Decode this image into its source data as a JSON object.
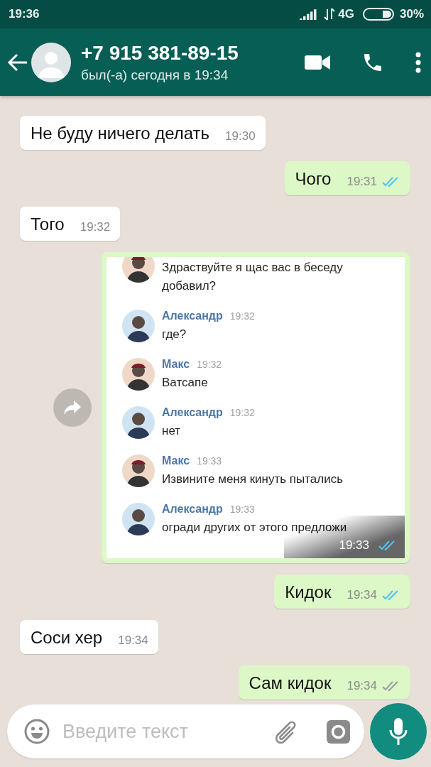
{
  "status_bar": {
    "time": "19:36",
    "network": "4G",
    "battery": "30%"
  },
  "header": {
    "contact": "+7 915 381-89-15",
    "last_seen": "был(-а) сегодня в 19:34"
  },
  "messages": [
    {
      "kind": "text",
      "outgoing": false,
      "text": "Не буду ничего делать",
      "time": "19:30"
    },
    {
      "kind": "text",
      "outgoing": true,
      "text": "Чого",
      "time": "19:31",
      "read": true
    },
    {
      "kind": "text",
      "outgoing": false,
      "text": "Того",
      "time": "19:32"
    },
    {
      "kind": "image",
      "outgoing": true,
      "time": "19:33",
      "read": true,
      "forward": true,
      "entries": [
        {
          "text": "Здраствуйте я щас вас в беседу добавил?"
        },
        {
          "sender": "Александр",
          "time": "19:32",
          "text": "где?"
        },
        {
          "sender": "Макс",
          "time": "19:32",
          "text": "Ватсапе"
        },
        {
          "sender": "Александр",
          "time": "19:32",
          "text": "нет"
        },
        {
          "sender": "Макс",
          "time": "19:33",
          "text": "Извините меня кинуть пытались"
        },
        {
          "sender": "Александр",
          "time": "19:33",
          "text": "огради других от этого предложи"
        }
      ]
    },
    {
      "kind": "text",
      "outgoing": true,
      "text": "Кидок",
      "time": "19:34",
      "read": true
    },
    {
      "kind": "text",
      "outgoing": false,
      "text": "Соси хер",
      "time": "19:34"
    },
    {
      "kind": "text",
      "outgoing": true,
      "text": "Сам кидок",
      "time": "19:34",
      "read": false
    }
  ],
  "composer": {
    "placeholder": "Введите текст"
  }
}
